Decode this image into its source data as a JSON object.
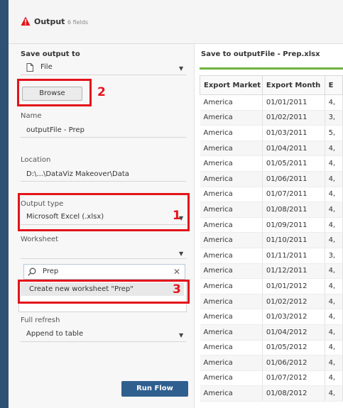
{
  "header": {
    "title": "Output",
    "fields_count": "6 fields",
    "warning_color": "#e3141a"
  },
  "left": {
    "save_output_to_label": "Save output to",
    "save_output_to_value": "File",
    "browse_label": "Browse",
    "name_label": "Name",
    "name_value": "outputFile - Prep",
    "location_label": "Location",
    "location_value": "D:\\...\\DataViz Makeover\\Data",
    "output_type_label": "Output type",
    "output_type_value": "Microsoft Excel (.xlsx)",
    "worksheet_label": "Worksheet",
    "search_value": "Prep",
    "create_item": "Create new worksheet \"Prep\"",
    "full_refresh_label": "Full refresh",
    "full_refresh_value": "Append to table",
    "run_flow_label": "Run Flow"
  },
  "annotations": {
    "n1": "1",
    "n2": "2",
    "n3": "3",
    "color": "#e3141a"
  },
  "preview": {
    "title": "Save to outputFile - Prep.xlsx",
    "columns": [
      "Export Market",
      "Export Month",
      "E"
    ],
    "rows": [
      [
        "America",
        "01/01/2011",
        "4,"
      ],
      [
        "America",
        "01/02/2011",
        "3,"
      ],
      [
        "America",
        "01/03/2011",
        "5,"
      ],
      [
        "America",
        "01/04/2011",
        "4,"
      ],
      [
        "America",
        "01/05/2011",
        "4,"
      ],
      [
        "America",
        "01/06/2011",
        "4,"
      ],
      [
        "America",
        "01/07/2011",
        "4,"
      ],
      [
        "America",
        "01/08/2011",
        "4,"
      ],
      [
        "America",
        "01/09/2011",
        "4,"
      ],
      [
        "America",
        "01/10/2011",
        "4,"
      ],
      [
        "America",
        "01/11/2011",
        "3,"
      ],
      [
        "America",
        "01/12/2011",
        "4,"
      ],
      [
        "America",
        "01/01/2012",
        "4,"
      ],
      [
        "America",
        "01/02/2012",
        "4,"
      ],
      [
        "America",
        "01/03/2012",
        "4,"
      ],
      [
        "America",
        "01/04/2012",
        "4,"
      ],
      [
        "America",
        "01/05/2012",
        "4,"
      ],
      [
        "America",
        "01/06/2012",
        "4,"
      ],
      [
        "America",
        "01/07/2012",
        "4,"
      ],
      [
        "America",
        "01/08/2012",
        "4,"
      ]
    ]
  }
}
